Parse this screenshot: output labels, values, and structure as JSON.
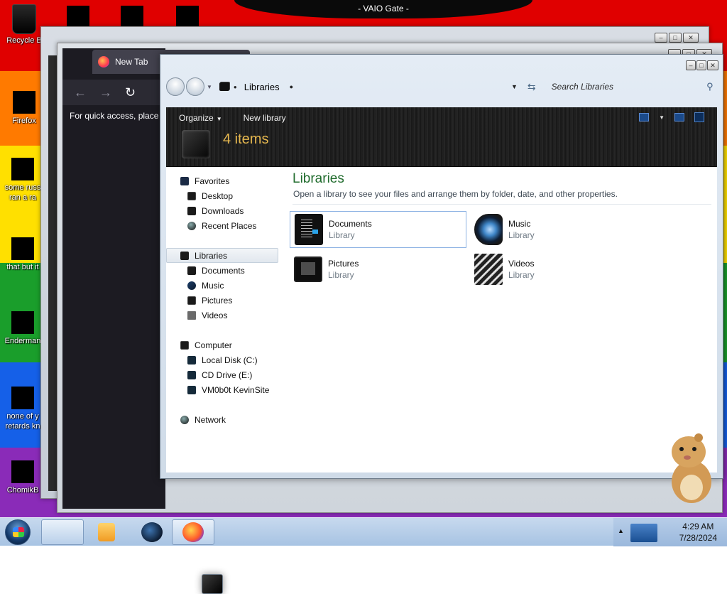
{
  "desktop": {
    "banner_title": "- VAIO Gate -",
    "icons": [
      {
        "name": "recycle-bin",
        "label": "Recycle B"
      },
      {
        "name": "firefox",
        "label": "Firefox"
      },
      {
        "name": "doc1",
        "label_line1": "some russ",
        "label_line2": "ran a ra"
      },
      {
        "name": "doc2",
        "label": "that but it"
      },
      {
        "name": "enderman",
        "label": "Enderman"
      },
      {
        "name": "doc3",
        "label_line1": "none of y",
        "label_line2": "retards kn"
      },
      {
        "name": "chomik",
        "label": "ChomikB"
      }
    ]
  },
  "firefox": {
    "tab_title": "New Tab",
    "quick_access_text": "For quick access, place y"
  },
  "explorer": {
    "address": "Libraries",
    "search_placeholder": "Search Libraries",
    "toolbar": {
      "organize": "Organize",
      "new_library": "New library"
    },
    "items_count": "4 items",
    "nav": {
      "favorites": "Favorites",
      "desktop": "Desktop",
      "downloads": "Downloads",
      "recent_places": "Recent Places",
      "libraries": "Libraries",
      "documents": "Documents",
      "music": "Music",
      "pictures": "Pictures",
      "videos": "Videos",
      "computer": "Computer",
      "local_disk": "Local Disk (C:)",
      "cd_drive": "CD Drive (E:)",
      "vm_share": "VM0b0t KevinSite",
      "network": "Network"
    },
    "heading": "Libraries",
    "subheading": "Open a library to see your files and arrange them by folder, date, and other properties.",
    "libraries": [
      {
        "name": "Documents",
        "type": "Library"
      },
      {
        "name": "Music",
        "type": "Library"
      },
      {
        "name": "Pictures",
        "type": "Library"
      },
      {
        "name": "Videos",
        "type": "Library"
      }
    ]
  },
  "taskbar": {
    "clock_time": "4:29 AM",
    "clock_date": "7/28/2024"
  }
}
